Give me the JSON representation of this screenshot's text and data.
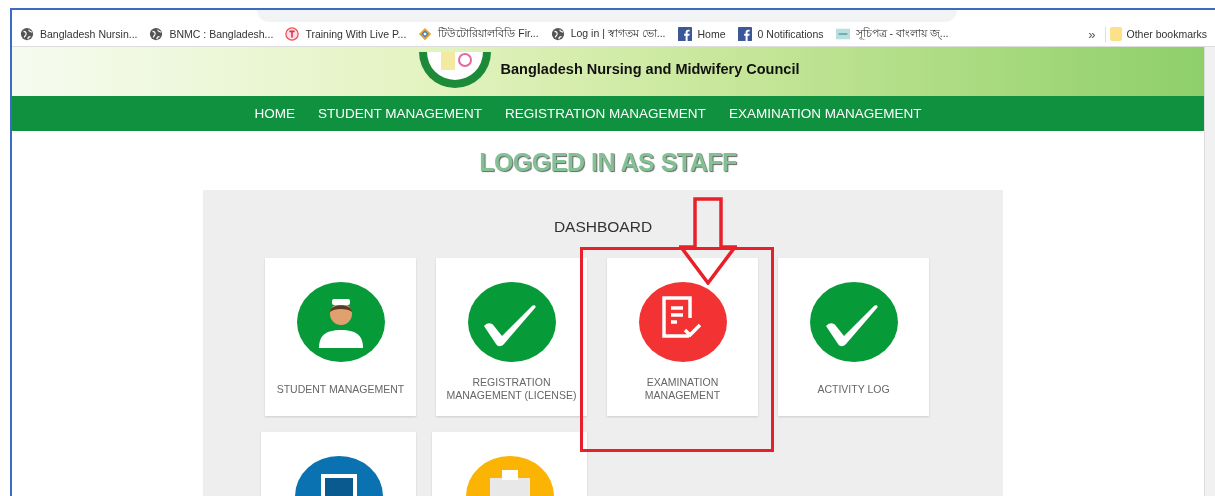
{
  "bookmarks": [
    {
      "kind": "globe",
      "label": "Bangladesh Nursin..."
    },
    {
      "kind": "globe",
      "label": "BNMC : Bangladesh..."
    },
    {
      "kind": "training",
      "label": "Training With Live P..."
    },
    {
      "kind": "diamond",
      "label": "টিউটোরিয়ালবিডি Fir..."
    },
    {
      "kind": "globe",
      "label": "Log in | স্বাগতম ভো..."
    },
    {
      "kind": "facebook",
      "label": "Home"
    },
    {
      "kind": "facebook",
      "label": "0 Notifications"
    },
    {
      "kind": "thumbnail",
      "label": "সূচিপত্র - বাংলায় জ্..."
    }
  ],
  "bookmarks_more": "»",
  "other_bookmarks": "Other bookmarks",
  "site": {
    "title": "Bangladesh Nursing and Midwifery Council"
  },
  "nav": [
    "HOME",
    "STUDENT MANAGEMENT",
    "REGISTRATION MANAGEMENT",
    "EXAMINATION MANAGEMENT"
  ],
  "heading": "LOGGED IN AS STAFF",
  "dashboard": {
    "title": "DASHBOARD",
    "cards": [
      {
        "kind": "nurse",
        "color": "#069a38",
        "label": "STUDENT MANAGEMENT",
        "highlighted": false
      },
      {
        "kind": "check",
        "color": "#069a38",
        "label": "REGISTRATION MANAGEMENT (LICENSE)",
        "highlighted": false
      },
      {
        "kind": "exam",
        "color": "#f33234",
        "label": "EXAMINATION MANAGEMENT",
        "highlighted": true
      },
      {
        "kind": "check",
        "color": "#069a38",
        "label": "ACTIVITY LOG",
        "highlighted": false
      },
      {
        "kind": "monitor",
        "color": "#0a72b0"
      },
      {
        "kind": "building",
        "color": "#fbb404"
      }
    ]
  }
}
